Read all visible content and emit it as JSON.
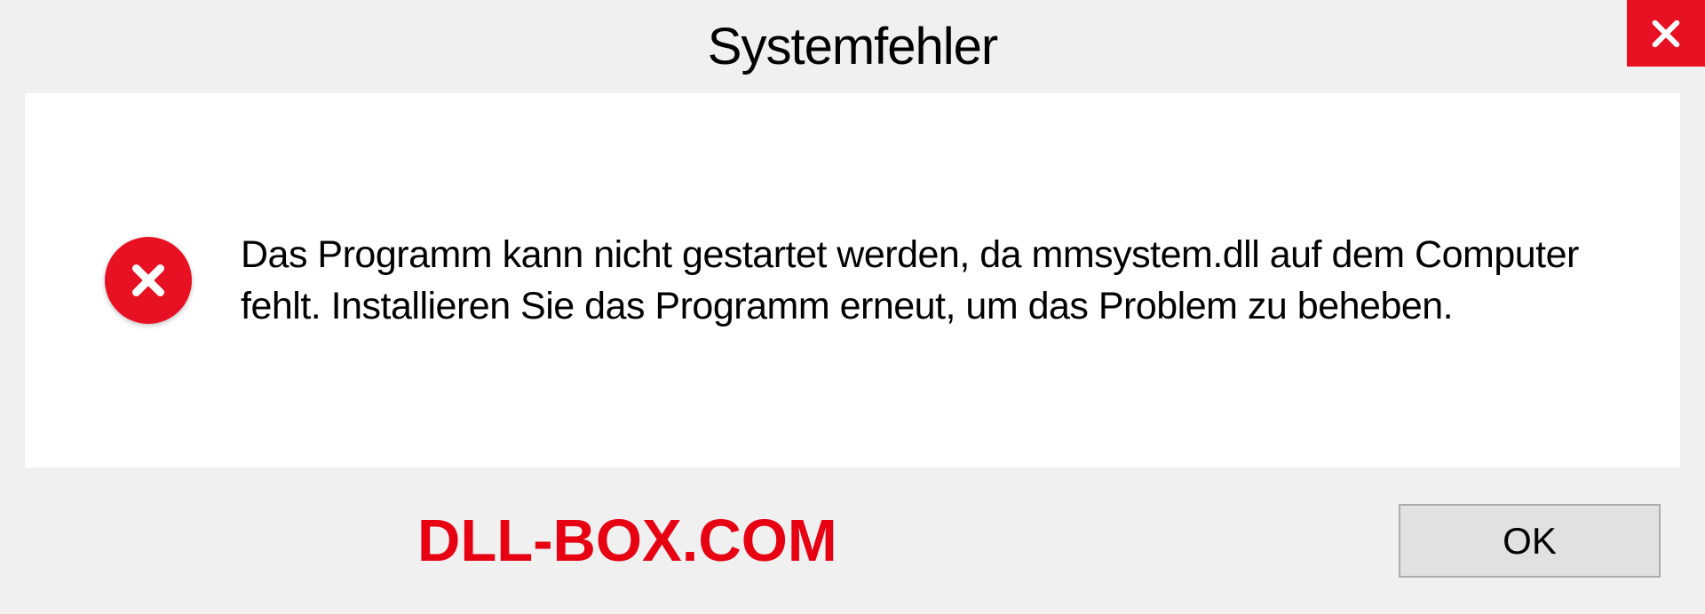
{
  "dialog": {
    "title": "Systemfehler",
    "message": "Das Programm kann nicht gestartet werden, da mmsystem.dll auf dem Computer fehlt. Installieren Sie das Programm erneut, um das Problem zu beheben.",
    "ok_label": "OK",
    "watermark": "DLL-BOX.COM"
  }
}
